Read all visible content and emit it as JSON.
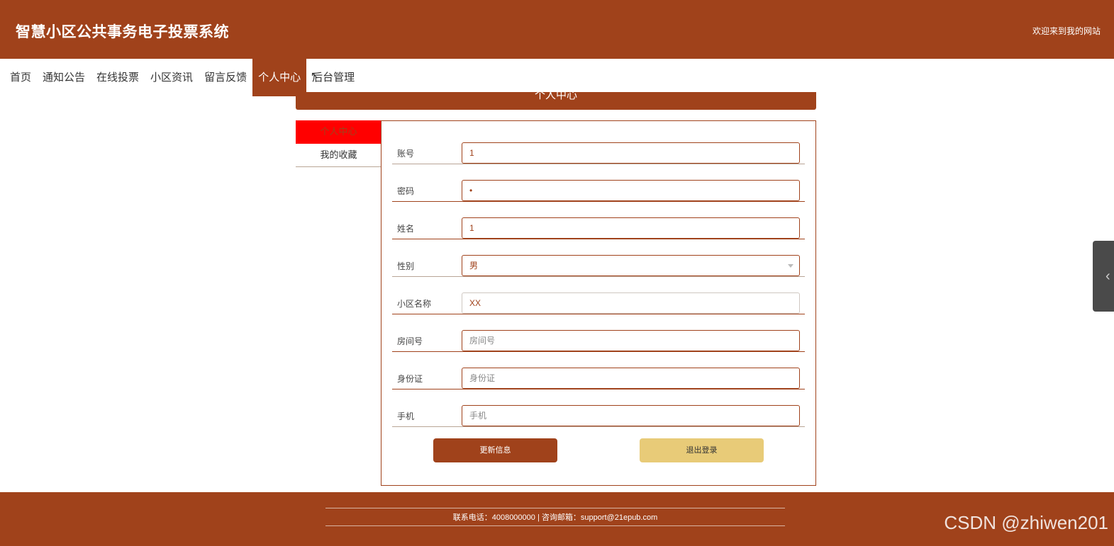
{
  "header": {
    "title": "智慧小区公共事务电子投票系统",
    "welcome": "欢迎来到我的网站"
  },
  "nav": {
    "items": [
      {
        "label": "首页"
      },
      {
        "label": "通知公告"
      },
      {
        "label": "在线投票"
      },
      {
        "label": "小区资讯"
      },
      {
        "label": "留言反馈"
      },
      {
        "label": "个人中心",
        "active": true
      },
      {
        "label": "后台管理"
      }
    ]
  },
  "section": {
    "title": "个人中心"
  },
  "side_menu": {
    "items": [
      {
        "label": "个人中心",
        "active": true
      },
      {
        "label": "我的收藏"
      }
    ]
  },
  "form": {
    "account": {
      "label": "账号",
      "value": "1"
    },
    "password": {
      "label": "密码",
      "value": "•"
    },
    "name": {
      "label": "姓名",
      "value": "1"
    },
    "gender": {
      "label": "性别",
      "value": "男"
    },
    "community": {
      "label": "小区名称",
      "value": "XX"
    },
    "room": {
      "label": "房间号",
      "placeholder": "房间号"
    },
    "id_card": {
      "label": "身份证",
      "placeholder": "身份证"
    },
    "phone": {
      "label": "手机",
      "placeholder": "手机"
    }
  },
  "buttons": {
    "update": "更新信息",
    "logout": "退出登录"
  },
  "footer": {
    "contact": "联系电话：4008000000 | 咨询邮箱：support@21epub.com"
  },
  "watermark": "CSDN @zhiwen201",
  "colors": {
    "brand": "#a0421b",
    "active_side": "#ff0000",
    "logout_button": "#e8cb78"
  }
}
